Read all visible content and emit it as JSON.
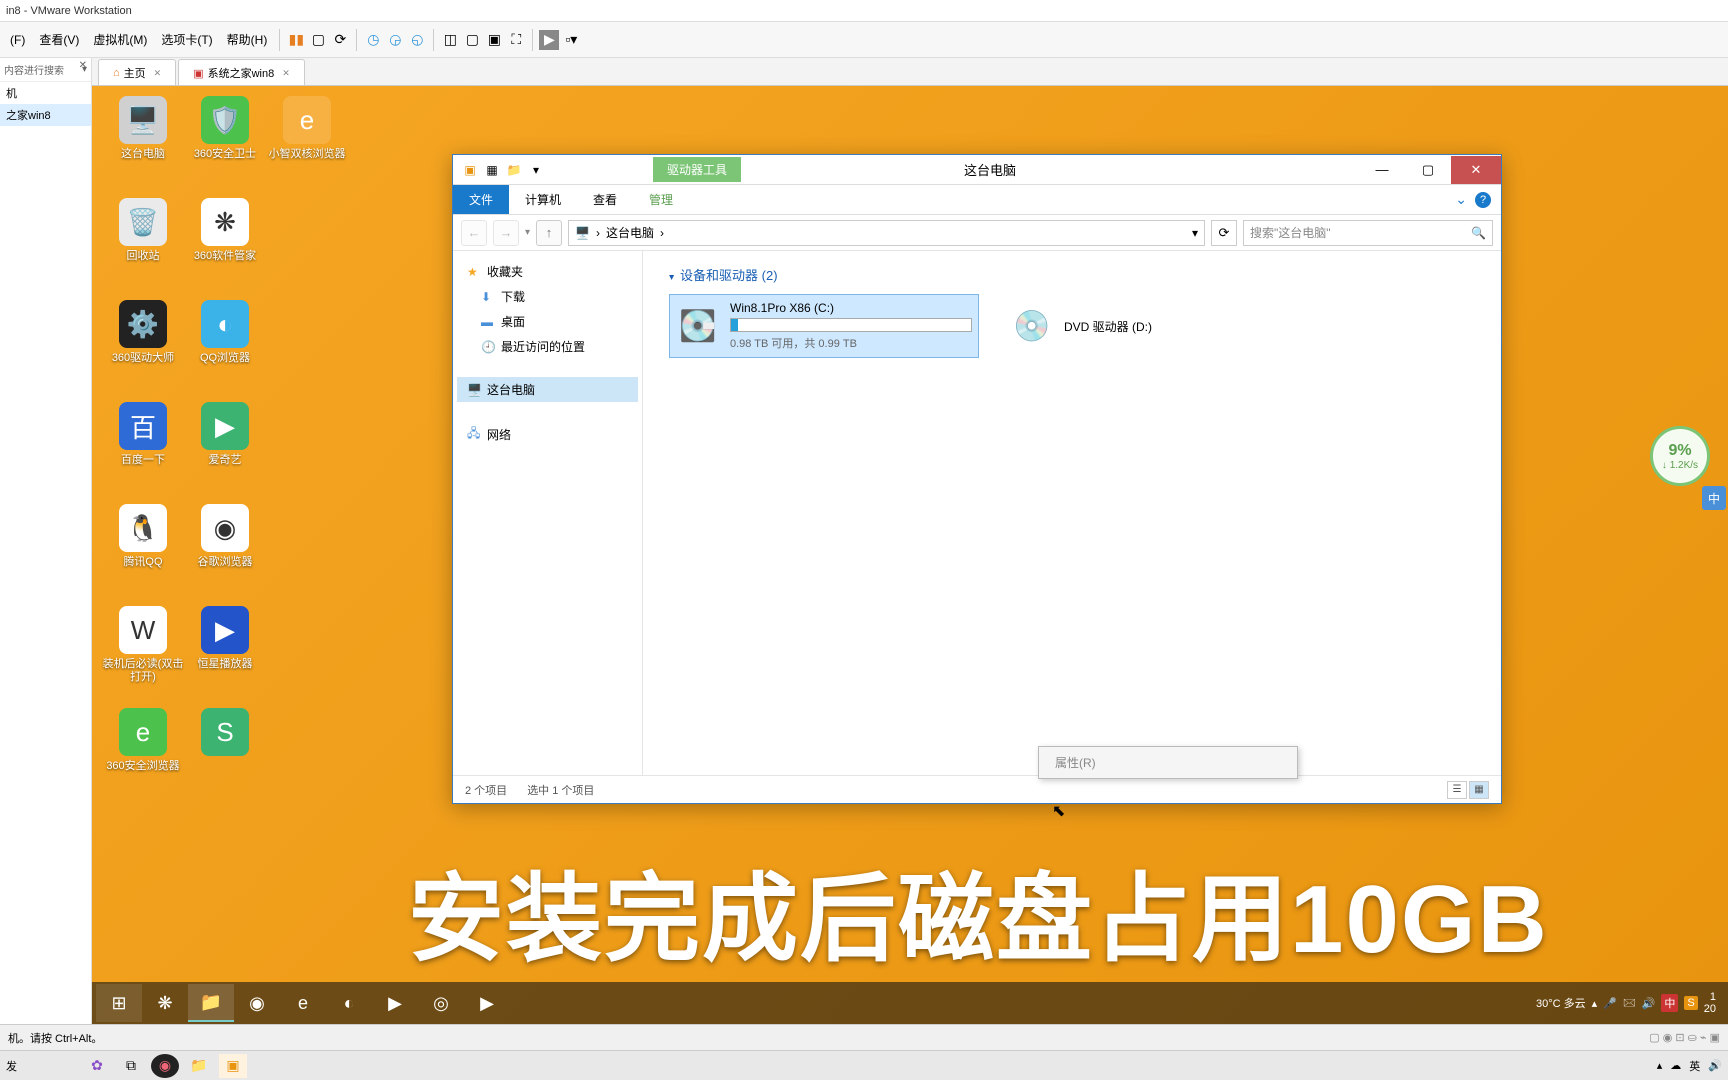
{
  "vmware": {
    "title": "in8 - VMware Workstation",
    "menus": [
      "(F)",
      "查看(V)",
      "虚拟机(M)",
      "选项卡(T)",
      "帮助(H)"
    ],
    "sidebar_search": "内容进行搜索",
    "tree": [
      "机",
      "之家win8"
    ],
    "tabs": [
      {
        "label": "主页",
        "home": true
      },
      {
        "label": "系统之家win8",
        "home": false
      }
    ],
    "status_left": "机。请按 Ctrl+Alt。",
    "status_right": ""
  },
  "desktop_icons": [
    [
      {
        "name": "这台电脑",
        "bg": "#d0d0d0",
        "glyph": "🖥️"
      },
      {
        "name": "360安全卫士",
        "bg": "#4cc24c",
        "glyph": "🛡️"
      },
      {
        "name": "小智双核浏览器",
        "bg": "#f7b042",
        "glyph": "e"
      }
    ],
    [
      {
        "name": "回收站",
        "bg": "#eaeaea",
        "glyph": "🗑️"
      },
      {
        "name": "360软件管家",
        "bg": "#fff",
        "glyph": "❋"
      }
    ],
    [
      {
        "name": "360驱动大师",
        "bg": "#222",
        "glyph": "⚙️"
      },
      {
        "name": "QQ浏览器",
        "bg": "#3bb3e8",
        "glyph": "◐"
      }
    ],
    [
      {
        "name": "百度一下",
        "bg": "#2e6bd6",
        "glyph": "百"
      },
      {
        "name": "爱奇艺",
        "bg": "#3cb371",
        "glyph": "▶"
      }
    ],
    [
      {
        "name": "腾讯QQ",
        "bg": "#fff",
        "glyph": "🐧"
      },
      {
        "name": "谷歌浏览器",
        "bg": "#fff",
        "glyph": "◉"
      }
    ],
    [
      {
        "name": "装机后必读(双击打开)",
        "bg": "#fff",
        "glyph": "W"
      },
      {
        "name": "恒星播放器",
        "bg": "#2354c9",
        "glyph": "▶"
      }
    ],
    [
      {
        "name": "360安全浏览器",
        "bg": "#4cc24c",
        "glyph": "e"
      },
      {
        "name": "",
        "bg": "#3cb371",
        "glyph": "S"
      }
    ]
  ],
  "explorer": {
    "context_tab": "驱动器工具",
    "title": "这台电脑",
    "ribbon": [
      "文件",
      "计算机",
      "查看",
      "管理"
    ],
    "breadcrumb": "这台电脑",
    "search_placeholder": "搜索\"这台电脑\"",
    "sidebar": {
      "fav_head": "收藏夹",
      "fav": [
        "下载",
        "桌面",
        "最近访问的位置"
      ],
      "thispc": "这台电脑",
      "network": "网络"
    },
    "group_header": "设备和驱动器 (2)",
    "drives": [
      {
        "name": "Win8.1Pro X86 (C:)",
        "sub": "0.98 TB 可用，共 0.99 TB",
        "icon": "💽",
        "selected": true,
        "bar": true
      },
      {
        "name": "DVD 驱动器 (D:)",
        "sub": "",
        "icon": "💿",
        "selected": false,
        "bar": false
      }
    ],
    "context_item": "属性(R)",
    "status_items": "2 个项目",
    "status_sel": "选中 1 个项目"
  },
  "speed": {
    "pct": "9%",
    "rate": "↓ 1.2K/s"
  },
  "taskbar": {
    "weather": "30°C 多云",
    "time": "1",
    "date": "20"
  },
  "caption": "安装完成后磁盘占用10GB",
  "host": {
    "left": "发"
  },
  "ime": "中"
}
